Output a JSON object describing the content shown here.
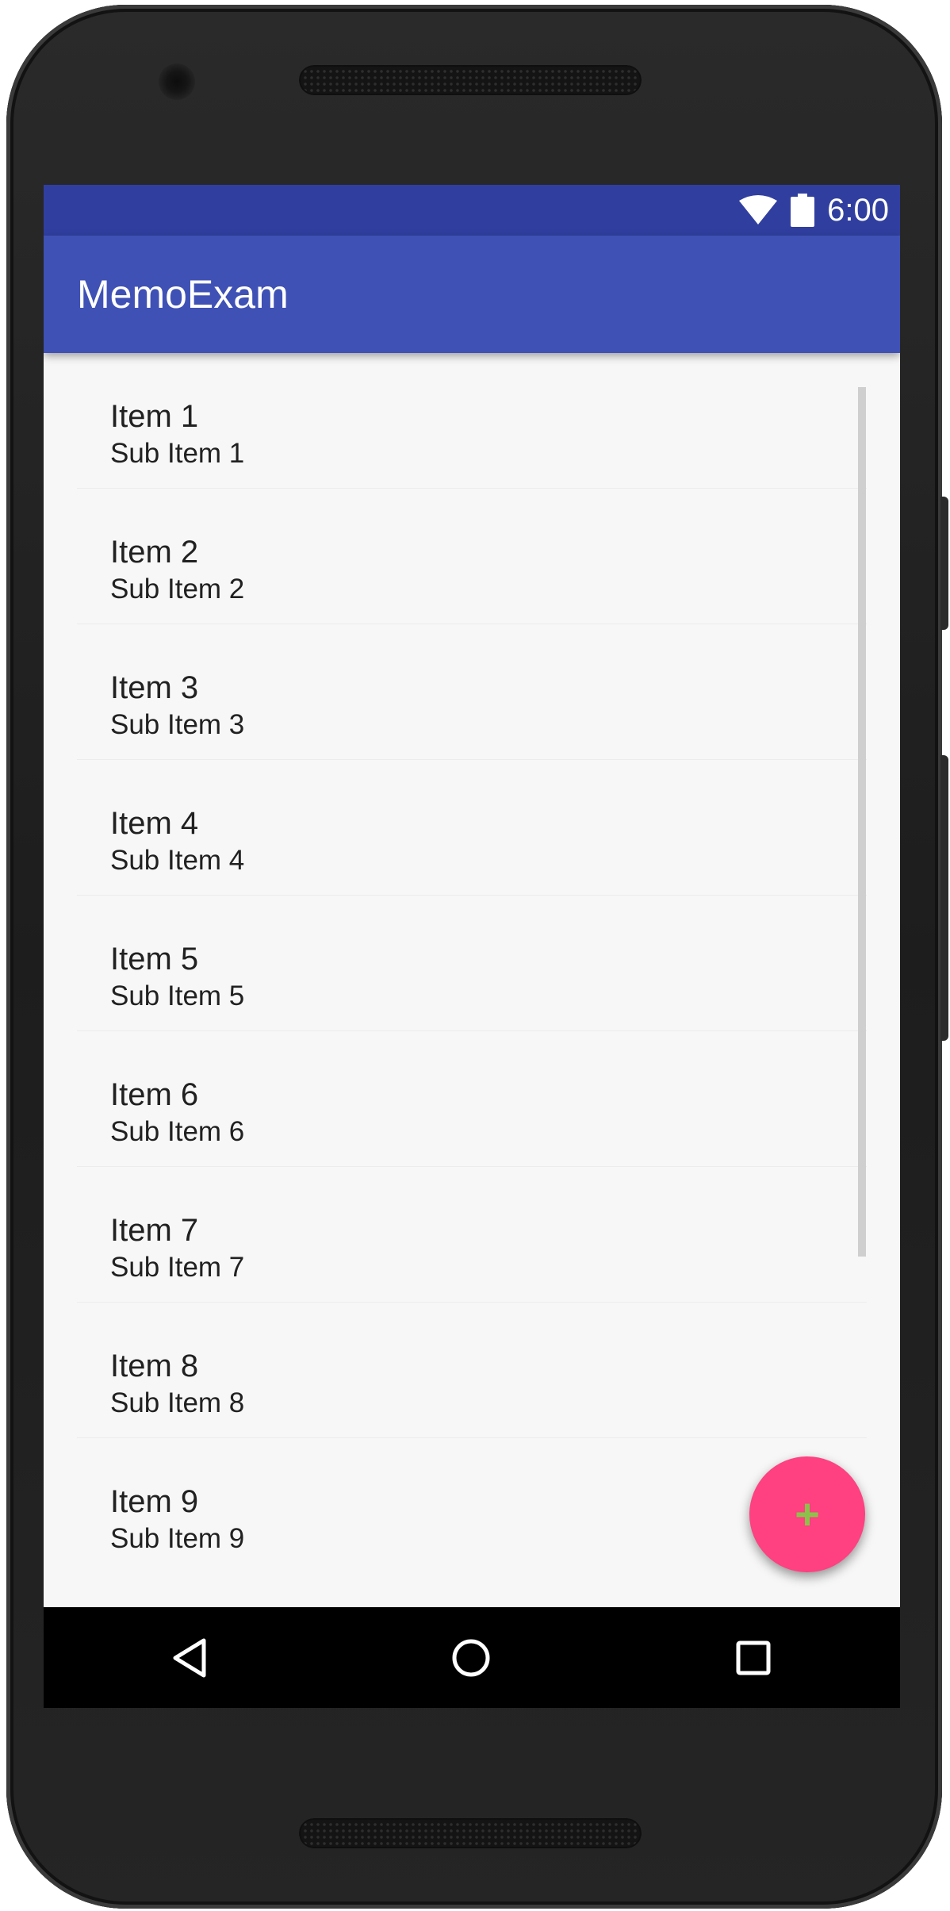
{
  "status_bar": {
    "time": "6:00",
    "icons": [
      "wifi-icon",
      "battery-icon"
    ],
    "color": "#303f9f"
  },
  "app_bar": {
    "title": "MemoExam",
    "color": "#3f51b5"
  },
  "list": {
    "items": [
      {
        "title": "Item 1",
        "subtitle": "Sub Item 1"
      },
      {
        "title": "Item 2",
        "subtitle": "Sub Item 2"
      },
      {
        "title": "Item 3",
        "subtitle": "Sub Item 3"
      },
      {
        "title": "Item 4",
        "subtitle": "Sub Item 4"
      },
      {
        "title": "Item 5",
        "subtitle": "Sub Item 5"
      },
      {
        "title": "Item 6",
        "subtitle": "Sub Item 6"
      },
      {
        "title": "Item 7",
        "subtitle": "Sub Item 7"
      },
      {
        "title": "Item 8",
        "subtitle": "Sub Item 8"
      },
      {
        "title": "Item 9",
        "subtitle": "Sub Item 9"
      }
    ]
  },
  "fab": {
    "icon": "plus-icon",
    "label": "+",
    "color": "#ff4081",
    "icon_color": "#8bc34a"
  },
  "nav_bar": {
    "buttons": [
      "back-icon",
      "home-icon",
      "recents-icon"
    ]
  }
}
